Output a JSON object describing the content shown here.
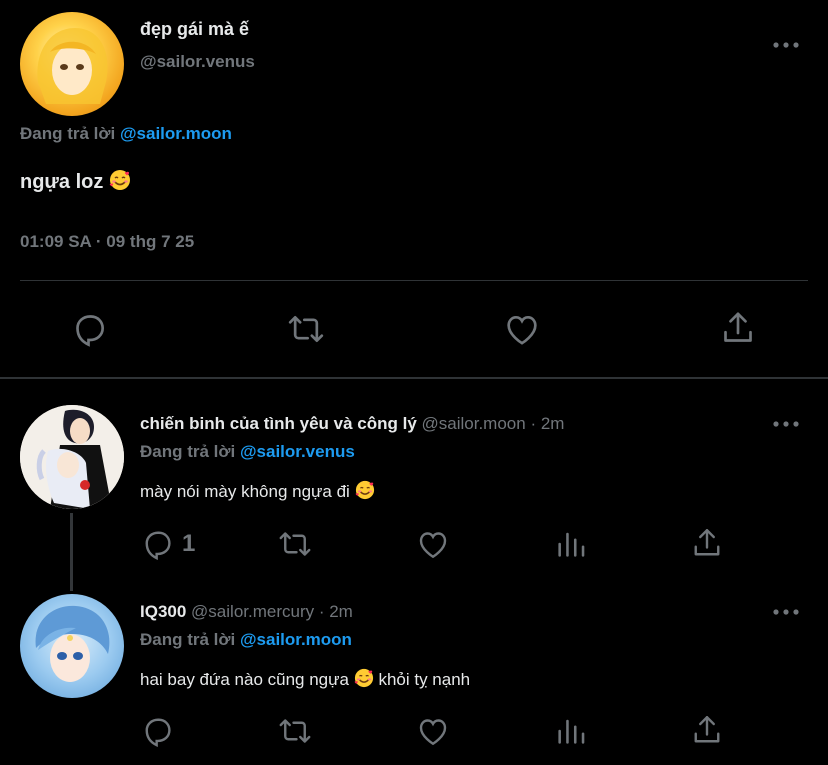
{
  "main_tweet": {
    "display_name": "đẹp gái mà ế",
    "handle": "@sailor.venus",
    "reply_prefix": "Đang trả lời",
    "reply_to": "@sailor.moon",
    "text": "ngựa loz",
    "timestamp": "01:09 SA · 09 thg 7 25"
  },
  "replies": [
    {
      "display_name": "chiến binh của tình yêu và công lý",
      "handle": "@sailor.moon",
      "time": "· 2m",
      "reply_prefix": "Đang trả lời",
      "reply_to": "@sailor.venus",
      "text": "mày nói mày không ngựa đi",
      "reply_count": "1"
    },
    {
      "display_name": "IQ300",
      "handle": "@sailor.mercury",
      "time": "· 2m",
      "reply_prefix": "Đang trả lời",
      "reply_to": "@sailor.moon",
      "text_before": "hai bay đứa nào cũng ngựa",
      "text_after": "khỏi tỵ nạnh"
    }
  ],
  "icons": [
    "more-icon",
    "reply-icon",
    "retweet-icon",
    "like-icon",
    "share-icon",
    "analytics-icon",
    "smiling-face-with-hearts-emoji"
  ],
  "colors": {
    "background": "#000000",
    "text": "#e7e9ea",
    "muted": "#71767b",
    "link": "#1d9bf0",
    "divider": "#2f3336"
  }
}
